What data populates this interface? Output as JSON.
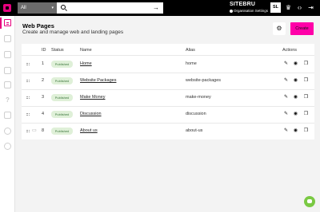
{
  "topbar": {
    "scope_label": "All",
    "search_placeholder": "",
    "go_glyph": "→",
    "brand": "SITEBRU",
    "org_settings": "Organisation Settings",
    "user_initials": "SL"
  },
  "page": {
    "title": "Web Pages",
    "subtitle": "Create and manage web and landing pages",
    "settings_glyph": "⚙",
    "create_label": "Create"
  },
  "table": {
    "headers": {
      "id": "ID",
      "status": "Status",
      "name": "Name",
      "alias": "Alias",
      "actions": "Actions"
    },
    "rows": [
      {
        "id": "1",
        "status": "Published",
        "name": "Home",
        "alias": "home"
      },
      {
        "id": "2",
        "status": "Published",
        "name": "Website Packages",
        "alias": "website-packages"
      },
      {
        "id": "3",
        "status": "Published",
        "name": "Make Money",
        "alias": "make-money"
      },
      {
        "id": "4",
        "status": "Published",
        "name": "Discussion",
        "alias": "discussion"
      },
      {
        "id": "8",
        "status": "Published",
        "name": "About us",
        "alias": "about-us"
      }
    ]
  },
  "colors": {
    "accent": "#e6007e",
    "create_button": "#ff00a8",
    "published_bg": "#dff0d8",
    "published_text": "#3c763d",
    "chat": "#7ac943"
  }
}
